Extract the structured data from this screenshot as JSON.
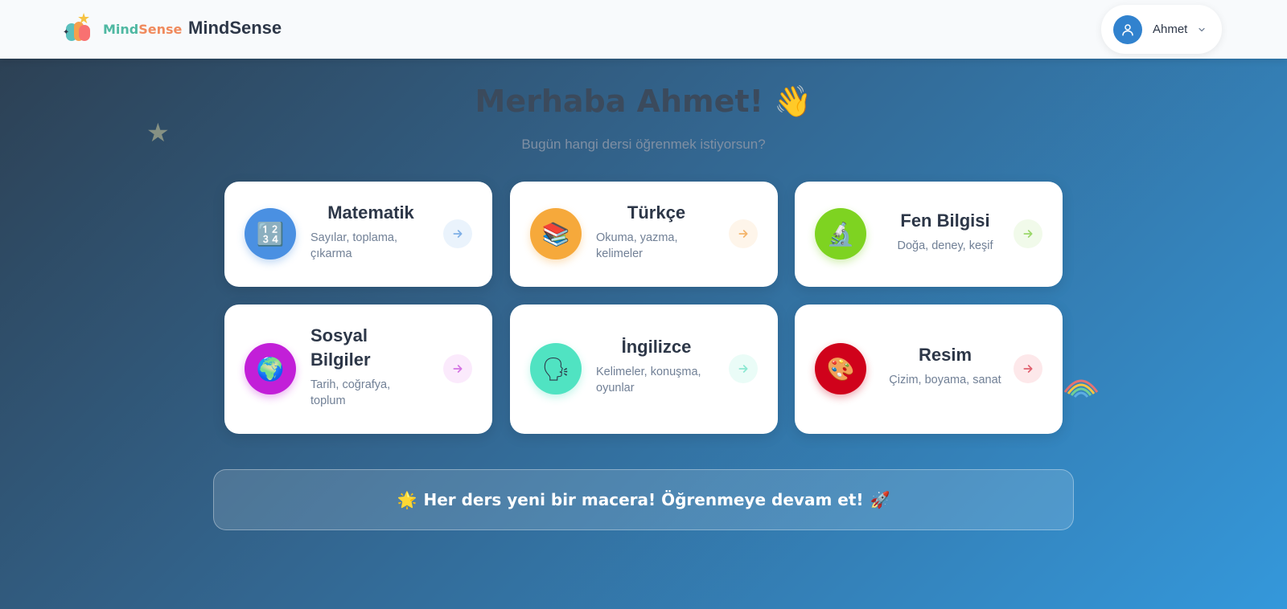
{
  "header": {
    "logo_mind": "Mind",
    "logo_sense": "Sense",
    "brand_title": "MindSense",
    "user": {
      "name": "Ahmet",
      "avatar_icon": "user-icon",
      "chevron_icon": "chevron-down-icon"
    }
  },
  "greeting": {
    "title": "Merhaba Ahmet!",
    "wave_emoji": "👋",
    "subtitle": "Bugün hangi dersi öğrenmek istiyorsun?"
  },
  "subjects": [
    {
      "title": "Matematik",
      "description": "Sayılar, toplama, çıkarma",
      "icon": "numbers-icon",
      "glyph": "🔢",
      "color": "#4a90e2",
      "arrow_bg": "#eaf3fc",
      "arrow_color": "#7fb0e6"
    },
    {
      "title": "Türkçe",
      "description": "Okuma, yazma, kelimeler",
      "icon": "books-icon",
      "glyph": "📚",
      "color": "#f6a93b",
      "arrow_bg": "#fef5ea",
      "arrow_color": "#f4b46a"
    },
    {
      "title": "Fen Bilgisi",
      "description": "Doğa, deney, keşif",
      "icon": "microscope-icon",
      "glyph": "🔬",
      "color": "#7ed321",
      "arrow_bg": "#f1faea",
      "arrow_color": "#9bd86a"
    },
    {
      "title": "Sosyal Bilgiler",
      "description": "Tarih, coğrafya, toplum",
      "icon": "globe-icon",
      "glyph": "🌍",
      "color": "#c21fd8",
      "arrow_bg": "#fbeafc",
      "arrow_color": "#d473e2"
    },
    {
      "title": "İngilizce",
      "description": "Kelimeler, konuşma, oyunlar",
      "icon": "speaking-head-icon",
      "glyph": "🗣",
      "color": "#50e3c2",
      "arrow_bg": "#eafcf7",
      "arrow_color": "#8be8d2"
    },
    {
      "title": "Resim",
      "description": "Çizim, boyama, sanat",
      "icon": "palette-icon",
      "glyph": "🎨",
      "color": "#d0021b",
      "arrow_bg": "#fde8ea",
      "arrow_color": "#e0616f"
    }
  ],
  "banner": {
    "star_emoji": "🌟",
    "text": "Her ders yeni bir macera! Öğrenmeye devam et!",
    "rocket_emoji": "🚀"
  },
  "decorations": {
    "star": "★",
    "rainbow_icon": "rainbow-icon"
  }
}
